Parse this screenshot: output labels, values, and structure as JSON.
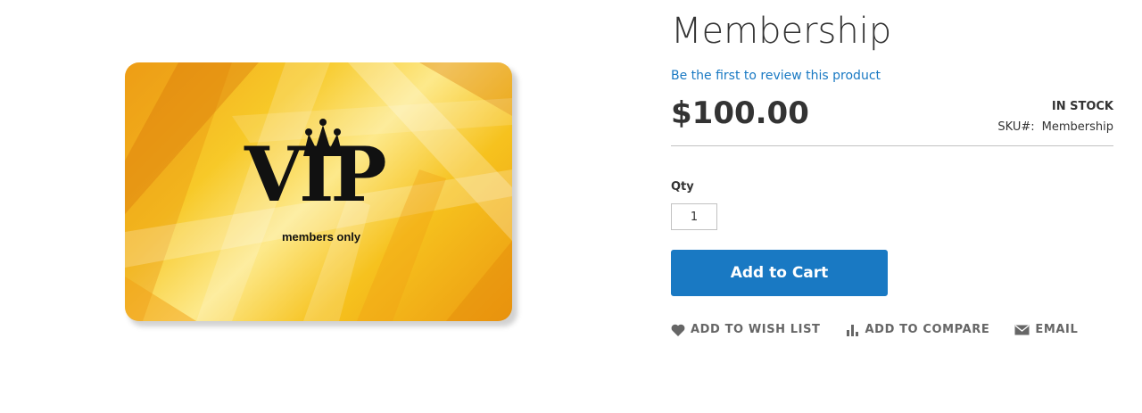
{
  "product": {
    "title": "Membership",
    "review_link": "Be the first to review this product",
    "price": "$100.00",
    "stock_status": "IN STOCK",
    "sku_label": "SKU#:",
    "sku_value": "Membership"
  },
  "image": {
    "card_title": "VIP",
    "card_subtitle": "members only",
    "colors": {
      "gold_light": "#fde98b",
      "gold": "#f7c928",
      "orange": "#ec9a10",
      "ink": "#111111"
    }
  },
  "form": {
    "qty_label": "Qty",
    "qty_value": "1",
    "add_to_cart_label": "Add to Cart"
  },
  "actions": {
    "wishlist": {
      "label": "ADD TO WISH LIST",
      "icon": "heart-icon"
    },
    "compare": {
      "label": "ADD TO COMPARE",
      "icon": "bar-chart-icon"
    },
    "email": {
      "label": "EMAIL",
      "icon": "envelope-icon"
    }
  },
  "colors": {
    "accent": "#1979c3",
    "text": "#333333",
    "muted": "#666666"
  }
}
